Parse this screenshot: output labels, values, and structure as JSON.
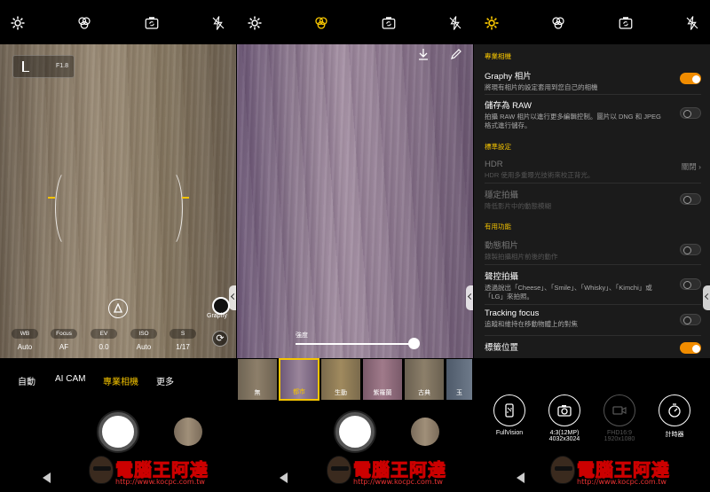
{
  "panel1": {
    "histogram_label": "F1.8",
    "graphy_label": "Graphy",
    "pro_controls": [
      {
        "label": "WB",
        "value": "Auto"
      },
      {
        "label": "Focus",
        "value": "AF"
      },
      {
        "label": "EV",
        "value": "0.0"
      },
      {
        "label": "ISO",
        "value": "Auto"
      },
      {
        "label": "S",
        "value": "1/17"
      }
    ],
    "modes": [
      "自動",
      "AI CAM",
      "專業相機",
      "更多"
    ],
    "active_mode": "專業相機"
  },
  "panel2": {
    "slider_label": "強度",
    "slider_value": 1.0,
    "filters": [
      "無",
      "都市",
      "生動",
      "紫羅蘭",
      "古典",
      "玉"
    ],
    "selected_filter": "都市"
  },
  "panel3": {
    "sections": {
      "pro": "專業相機",
      "standard": "標準設定",
      "useful": "有用功能"
    },
    "graphy": {
      "title": "Graphy 相片",
      "desc": "將現有相片的設定套用到您自己的相機",
      "on": true
    },
    "raw": {
      "title": "儲存為 RAW",
      "desc": "拍攝 RAW 相片以進行更多編輯控制。圖片以 DNG 和 JPEG 格式進行儲存。",
      "on": false
    },
    "hdr": {
      "title": "HDR",
      "desc": "HDR 使用多重曝光技術來校正背光。",
      "value": "關閉 ›"
    },
    "stabilize": {
      "title": "穩定拍攝",
      "desc": "降低影片中的動態模糊",
      "on": false
    },
    "motion": {
      "title": "動態相片",
      "desc": "錄製拍攝相片前後的動作",
      "on": false
    },
    "voice": {
      "title": "聲控拍攝",
      "desc": "透過說出「Cheese」、「Smile」、「Whisky」、「Kimchi」或「LG」來拍照。",
      "on": false
    },
    "tracking": {
      "title": "Tracking focus",
      "desc": "追蹤和維持在移動物體上的對焦",
      "on": false
    },
    "location": {
      "title": "標籤位置",
      "on": true
    },
    "features": [
      {
        "l1": "FullVision",
        "l2": ""
      },
      {
        "l1": "4:3(12MP)",
        "l2": "4032x3024"
      },
      {
        "l1": "FHD16:9",
        "l2": "1920x1080"
      },
      {
        "l1": "計時器",
        "l2": ""
      }
    ]
  },
  "watermark": {
    "title": "電腦王阿達",
    "url": "http://www.kocpc.com.tw"
  },
  "colors": {
    "accent": "#f5c400",
    "toggle_on": "#f08c00"
  }
}
